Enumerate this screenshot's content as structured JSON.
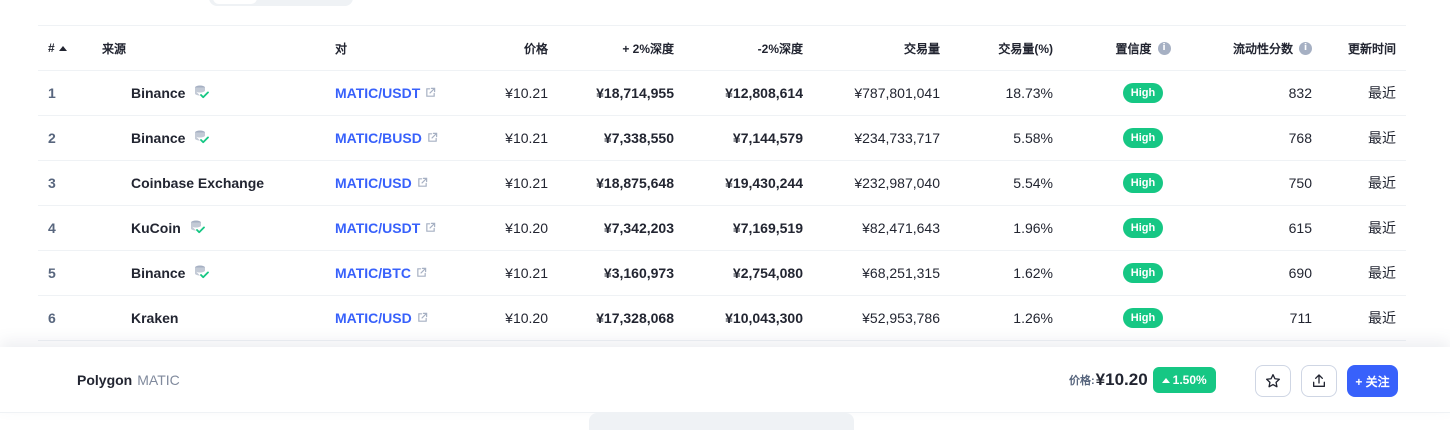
{
  "table": {
    "headers": {
      "num": "#",
      "source": "来源",
      "pair": "对",
      "price": "价格",
      "plus_depth": "+ 2%深度",
      "minus_depth": "-2%深度",
      "volume": "交易量",
      "volume_pct": "交易量(%)",
      "confidence": "置信度",
      "liquidity": "流动性分数",
      "updated": "更新时间"
    },
    "rows": [
      {
        "num": "1",
        "exchange": "Binance",
        "verified": true,
        "pair": "MATIC/USDT",
        "price": "¥10.21",
        "plus_depth": "¥18,714,955",
        "minus_depth": "¥12,808,614",
        "volume": "¥787,801,041",
        "volume_pct": "18.73%",
        "confidence": "High",
        "liquidity": "832",
        "updated": "最近"
      },
      {
        "num": "2",
        "exchange": "Binance",
        "verified": true,
        "pair": "MATIC/BUSD",
        "price": "¥10.21",
        "plus_depth": "¥7,338,550",
        "minus_depth": "¥7,144,579",
        "volume": "¥234,733,717",
        "volume_pct": "5.58%",
        "confidence": "High",
        "liquidity": "768",
        "updated": "最近"
      },
      {
        "num": "3",
        "exchange": "Coinbase Exchange",
        "verified": false,
        "pair": "MATIC/USD",
        "price": "¥10.21",
        "plus_depth": "¥18,875,648",
        "minus_depth": "¥19,430,244",
        "volume": "¥232,987,040",
        "volume_pct": "5.54%",
        "confidence": "High",
        "liquidity": "750",
        "updated": "最近"
      },
      {
        "num": "4",
        "exchange": "KuCoin",
        "verified": true,
        "pair": "MATIC/USDT",
        "price": "¥10.20",
        "plus_depth": "¥7,342,203",
        "minus_depth": "¥7,169,519",
        "volume": "¥82,471,643",
        "volume_pct": "1.96%",
        "confidence": "High",
        "liquidity": "615",
        "updated": "最近"
      },
      {
        "num": "5",
        "exchange": "Binance",
        "verified": true,
        "pair": "MATIC/BTC",
        "price": "¥10.21",
        "plus_depth": "¥3,160,973",
        "minus_depth": "¥2,754,080",
        "volume": "¥68,251,315",
        "volume_pct": "1.62%",
        "confidence": "High",
        "liquidity": "690",
        "updated": "最近"
      },
      {
        "num": "6",
        "exchange": "Kraken",
        "verified": false,
        "pair": "MATIC/USD",
        "price": "¥10.20",
        "plus_depth": "¥17,328,068",
        "minus_depth": "¥10,043,300",
        "volume": "¥52,953,786",
        "volume_pct": "1.26%",
        "confidence": "High",
        "liquidity": "711",
        "updated": "最近"
      }
    ]
  },
  "bottom_bar": {
    "coin_name": "Polygon",
    "coin_symbol": "MATIC",
    "price_label": "价格:",
    "price_value": "¥10.20",
    "change": "1.50%",
    "follow_label": "+ 关注"
  },
  "icons": {
    "sort": "sort-ascending-icon",
    "info": "info-icon",
    "external": "external-link-icon",
    "verified": "verified-exchange-icon",
    "star": "star-icon",
    "share": "share-icon"
  },
  "colors": {
    "accent": "#3861fb",
    "positive": "#16c784",
    "text": "#222531",
    "muted": "#58667e"
  }
}
